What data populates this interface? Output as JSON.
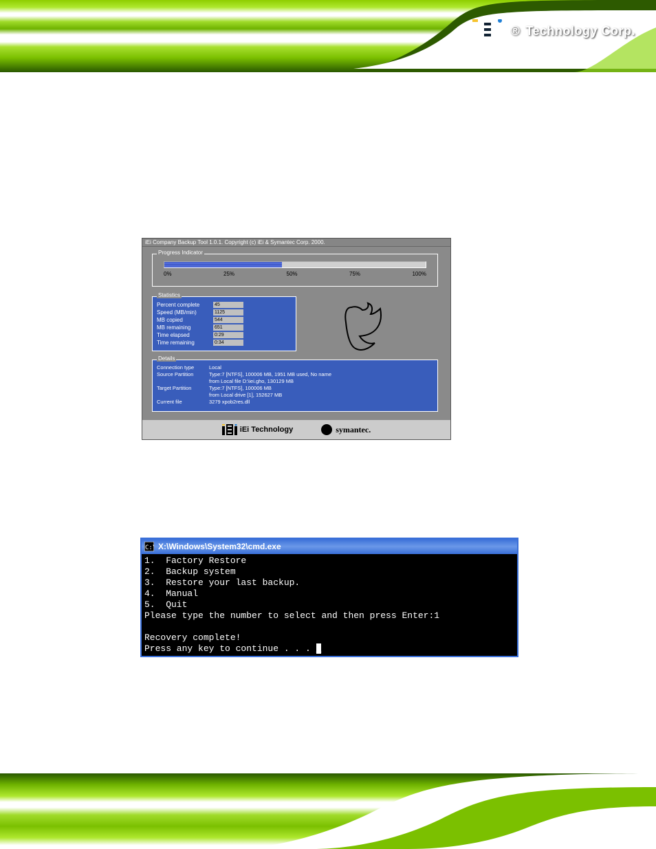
{
  "header": {
    "brand_text": "Technology Corp.",
    "reg_mark": "®"
  },
  "dialog": {
    "title": "iEi Company Backup Tool 1.0.1.   Copyright (c) iEi & Symantec Corp. 2000.",
    "progress": {
      "legend": "Progress Indicator",
      "percent_fill": 45,
      "ticks": [
        "0%",
        "25%",
        "50%",
        "75%",
        "100%"
      ]
    },
    "stats": {
      "legend": "Statistics",
      "rows": [
        {
          "label": "Percent complete",
          "value": "45"
        },
        {
          "label": "Speed (MB/min)",
          "value": "1125"
        },
        {
          "label": "MB copied",
          "value": "544"
        },
        {
          "label": "MB remaining",
          "value": "651"
        },
        {
          "label": "Time elapsed",
          "value": "0:29"
        },
        {
          "label": "Time remaining",
          "value": "0:34"
        }
      ]
    },
    "details": {
      "legend": "Details",
      "rows": [
        {
          "label": "Connection type",
          "value": "Local"
        },
        {
          "label": "Source Partition",
          "value": "Type:7 [NTFS], 100006 MB, 1951 MB used, No name"
        },
        {
          "label": "",
          "value": "from Local file D:\\iei.gho, 130129 MB"
        },
        {
          "label": "Target Partition",
          "value": "Type:7 [NTFS], 100006 MB"
        },
        {
          "label": "",
          "value": "from Local drive [1], 152627 MB"
        },
        {
          "label": "Current file",
          "value": "3279 xpob2res.dll"
        }
      ]
    },
    "brands": {
      "iei": "iEi Technology",
      "symantec": "symantec."
    }
  },
  "cmd": {
    "title_prefix": "C:\\",
    "title": "X:\\Windows\\System32\\cmd.exe",
    "lines": [
      "1.  Factory Restore",
      "2.  Backup system",
      "3.  Restore your last backup.",
      "4.  Manual",
      "5.  Quit",
      "Please type the number to select and then press Enter:1",
      "",
      "Recovery complete!",
      "Press any key to continue . . . "
    ],
    "cursor": "_"
  }
}
